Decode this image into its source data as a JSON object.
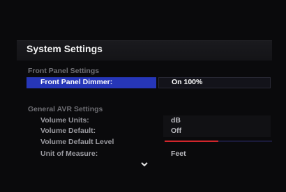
{
  "screen": {
    "title": "System Settings",
    "sections": [
      {
        "heading": "Front Panel Settings",
        "rows": [
          {
            "label": "Front Panel Dimmer:",
            "value": "On 100%",
            "selected": true
          }
        ]
      },
      {
        "heading": "General AVR Settings",
        "rows": [
          {
            "label": "Volume Units:",
            "value": "dB"
          },
          {
            "label": "Volume Default:",
            "value": "Off"
          },
          {
            "label": "Volume Default Level",
            "value": "",
            "level_fraction": 0.5
          },
          {
            "label": "Unit of Measure:",
            "value": "Feet"
          }
        ]
      }
    ],
    "scroll_icon": "chevron-down-icon",
    "colors": {
      "highlight": "#2636b8",
      "level_fill": "#d1262c",
      "level_track": "#1a1a3a"
    }
  }
}
